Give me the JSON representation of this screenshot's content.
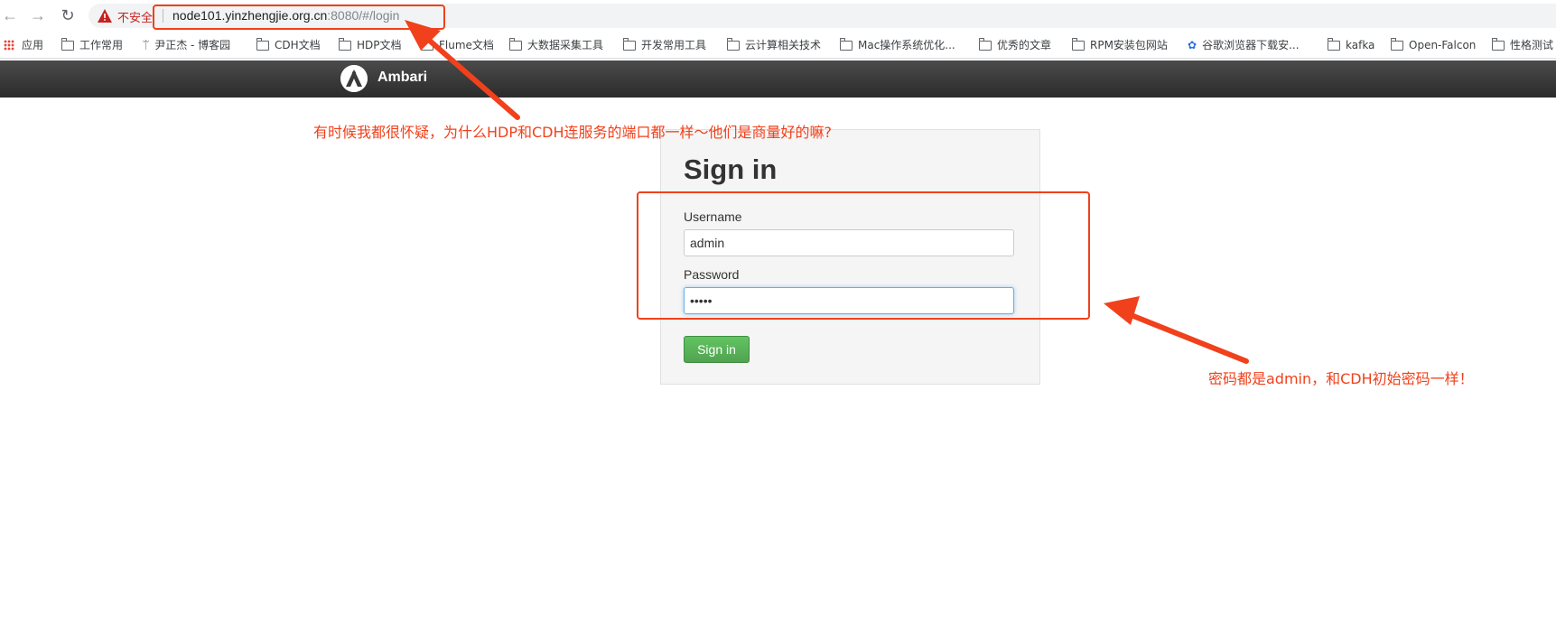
{
  "browser": {
    "insecure_label": "不安全",
    "url_host": "node101.yinzhengjie.org.cn",
    "url_path": ":8080/#/login",
    "bookmarks": [
      {
        "label": "应用",
        "icon": "apps-grid-icon"
      },
      {
        "label": "工作常用",
        "icon": "folder-icon"
      },
      {
        "label": "尹正杰 - 博客园",
        "icon": "blog-icon"
      },
      {
        "label": "CDH文档",
        "icon": "folder-icon"
      },
      {
        "label": "HDP文档",
        "icon": "folder-icon"
      },
      {
        "label": "Flume文档",
        "icon": "folder-icon"
      },
      {
        "label": "大数据采集工具",
        "icon": "folder-icon"
      },
      {
        "label": "开发常用工具",
        "icon": "folder-icon"
      },
      {
        "label": "云计算相关技术",
        "icon": "folder-icon"
      },
      {
        "label": "Mac操作系统优化...",
        "icon": "folder-icon"
      },
      {
        "label": "优秀的文章",
        "icon": "folder-icon"
      },
      {
        "label": "RPM安装包网站",
        "icon": "folder-icon"
      },
      {
        "label": "谷歌浏览器下载安...",
        "icon": "paw-icon"
      },
      {
        "label": "kafka",
        "icon": "folder-icon"
      },
      {
        "label": "Open-Falcon",
        "icon": "folder-icon"
      },
      {
        "label": "性格测试",
        "icon": "folder-icon"
      }
    ]
  },
  "app": {
    "name": "Ambari"
  },
  "login": {
    "heading": "Sign in",
    "username_label": "Username",
    "username_value": "admin",
    "password_label": "Password",
    "password_value": "•••••",
    "submit_label": "Sign in"
  },
  "annotations": {
    "top_note": "有时候我都很怀疑，为什么HDP和CDH连服务的端口都一样～他们是商量好的嘛?",
    "side_note": "密码都是admin，和CDH初始密码一样！",
    "color": "#f0411c"
  },
  "colors": {
    "ambari_bar": "#333333",
    "signin_button": "#5bb75b",
    "focus_border": "#66afe9"
  }
}
